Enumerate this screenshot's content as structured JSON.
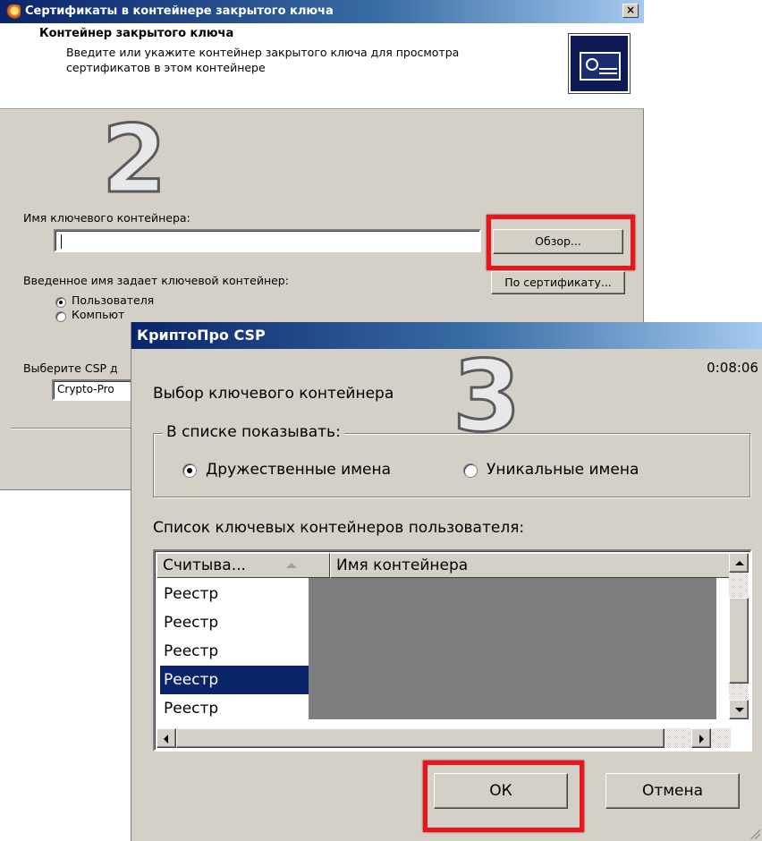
{
  "dialog1": {
    "title": "Сертификаты в контейнере закрытого ключа",
    "close": "×",
    "header_title": "Контейнер закрытого ключа",
    "header_desc": "Введите или укажите контейнер закрытого ключа для просмотра сертификатов в этом контейнере",
    "step_number": "2",
    "container_label": "Имя ключевого контейнера:",
    "container_value": "",
    "browse_button": "Обзор...",
    "by_cert_button": "По сертификату...",
    "scope_label": "Введенное имя задает ключевой контейнер:",
    "scope_options": [
      "Пользователя",
      "Компьют"
    ],
    "csp_label": "Выберите CSP д",
    "csp_value": "Crypto-Pro"
  },
  "dialog2": {
    "title": "КриптоПро CSP",
    "timer": "0:08:06",
    "step_number": "3",
    "heading": "Выбор ключевого контейнера",
    "show_group_label": "В списке показывать:",
    "show_options": [
      "Дружественные имена",
      "Уникальные имена"
    ],
    "list_label": "Список ключевых контейнеров пользователя:",
    "columns": [
      "Считыва...",
      "Имя контейнера"
    ],
    "rows": [
      "Реестр",
      "Реестр",
      "Реестр",
      "Реестр",
      "Реестр"
    ],
    "selected_row": 3,
    "ok_button": "ОК",
    "cancel_button": "Отмена"
  },
  "colors": {
    "highlight_box": "#e8151b",
    "selection": "#0a246a",
    "dialog_bg": "#d4d0c8"
  }
}
